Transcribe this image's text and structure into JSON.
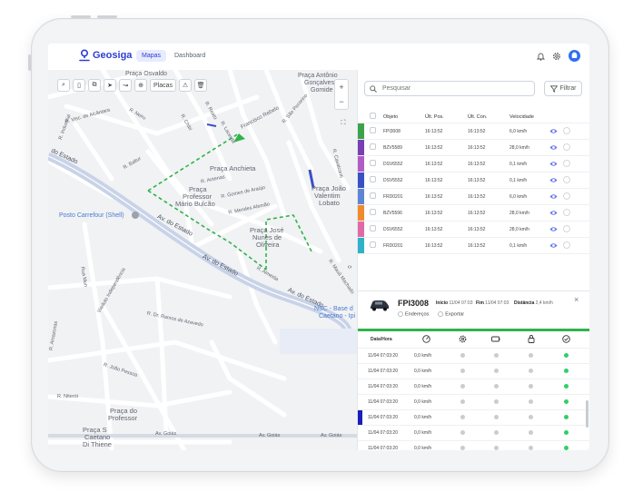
{
  "app": {
    "name": "Geosiga"
  },
  "nav": {
    "tabs": [
      {
        "label": "Mapas"
      },
      {
        "label": "Dashboard"
      }
    ]
  },
  "header": {
    "icons": [
      "bell-icon",
      "gear-icon",
      "user-avatar-icon"
    ]
  },
  "map": {
    "toolbar": {
      "plates_label": "Placas"
    },
    "labels": {
      "l1": "Praça Osvaldo",
      "l2": "Praça Antônio",
      "l3": "Gonçalves",
      "l4": "Gomide",
      "l5": "R. Industrial",
      "l6": "R. Visc. de Alcântara",
      "l7": "R. Neiru",
      "l8": "R. Chibi",
      "l9": "R. Reato",
      "l10": "R. Lacerda",
      "l11": "Francisco Rebelo",
      "l12": "R. São Pecorino",
      "l13": "do Estado",
      "l14": "R. Baltur",
      "l15": "Praça Anchieta",
      "l16": "R. Antenas",
      "l17": "Praça",
      "l18": "Professor",
      "l19": "Mário Bulcão",
      "l20": "R. Gomes de Araújo",
      "l21": "R. Mendes Alemão",
      "l22": "Praça João",
      "l23": "Valentim",
      "l24": "Lobato",
      "l25": "Posto Carrefour (Shell)",
      "l26": "Av. do Estado",
      "l27": "Praça José",
      "l28": "Nunes de",
      "l29": "Oliveira",
      "l30": "Av. do Estado",
      "l31": "R. Almeida",
      "l32": "Av. do Estado",
      "l33": "NSC - Base d",
      "l34": "Caetano - Ipi",
      "l35": "R. Dr. Ramos de Azevedo",
      "l36": "R. João Pessoa",
      "l37": "Viaduto Independência",
      "l38": "R. Niterói",
      "l39": "Praça do",
      "l40": "Professor",
      "l41": "Praça S",
      "l42": "Caetano",
      "l43": "Di Thiene",
      "l44": "Av. Goiás",
      "l45": "Av. Goiás",
      "l46": "Av. Goiás",
      "l47": "Rua Mun",
      "l48": "R. Amazonas",
      "l49": "R. Mauá Machado",
      "l50": "R. Cavalcanti"
    }
  },
  "search": {
    "placeholder": "Pesquisar",
    "filter_label": "Filtrar"
  },
  "objects": {
    "columns": [
      "Objeto",
      "Últ. Pos.",
      "Últ. Con.",
      "Velocidade"
    ],
    "rows": [
      {
        "name": "FPI3008",
        "pos": "16:13:52",
        "con": "16:13:52",
        "speed": "6,0 km/h",
        "color": "#3aa34a"
      },
      {
        "name": "BZV5589",
        "pos": "16:13:52",
        "con": "16:13:52",
        "speed": "28,0 km/h",
        "color": "#7a3fb3"
      },
      {
        "name": "DSV6552",
        "pos": "16:13:52",
        "con": "16:13:52",
        "speed": "0,1 km/h",
        "color": "#b05cc7"
      },
      {
        "name": "DSV5552",
        "pos": "16:13:52",
        "con": "16:13:52",
        "speed": "0,1 km/h",
        "color": "#3b4fc4"
      },
      {
        "name": "FRD0201",
        "pos": "16:13:52",
        "con": "16:13:52",
        "speed": "6,0 km/h",
        "color": "#5d86d6"
      },
      {
        "name": "BZV5596",
        "pos": "16:13:52",
        "con": "16:13:52",
        "speed": "28,0 km/h",
        "color": "#f08a2c"
      },
      {
        "name": "DSV6552",
        "pos": "16:13:52",
        "con": "16:13:52",
        "speed": "28,0 km/h",
        "color": "#e06aa6"
      },
      {
        "name": "FRD0201",
        "pos": "16:13:52",
        "con": "16:13:52",
        "speed": "0,1 km/h",
        "color": "#2fb2c9"
      }
    ]
  },
  "detail": {
    "title": "FPI3008",
    "start_label": "Início",
    "start_value": "11/04 07:03",
    "end_label": "Fim",
    "end_value": "11/04 07:03",
    "distance_label": "Distância",
    "distance_value": "2,4 km/h",
    "links": [
      "Endereços",
      "Exportar"
    ],
    "history_header": "Data/Hora",
    "history_icons": [
      "speed-icon",
      "gear-icon",
      "battery-icon",
      "lock-icon",
      "check-icon"
    ],
    "history": [
      {
        "time": "11/04 07:03:20",
        "speed": "0,0 km/h"
      },
      {
        "time": "11/04 07:03:20",
        "speed": "0,0 km/h"
      },
      {
        "time": "11/04 07:03:20",
        "speed": "0,0 km/h"
      },
      {
        "time": "11/04 07:03:20",
        "speed": "0,0 km/h"
      },
      {
        "time": "11/04 07:03:20",
        "speed": "0,0 km/h"
      },
      {
        "time": "11/04 07:03:20",
        "speed": "0,0 km/h"
      },
      {
        "time": "11/04 07:03:20",
        "speed": "0,0 km/h"
      }
    ]
  },
  "colors": {
    "brand": "#2b3fd1",
    "route": "#2fb34a",
    "status_on": "#2fcf6a",
    "status_off": "#c9ccd1"
  }
}
